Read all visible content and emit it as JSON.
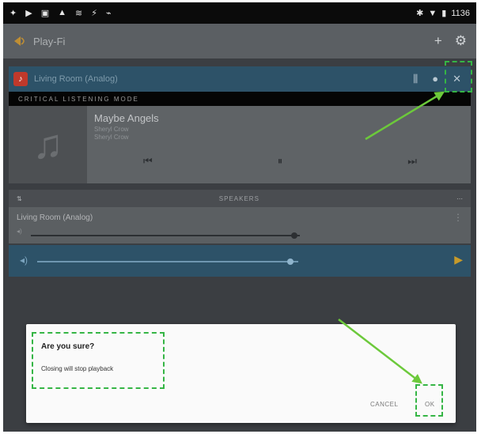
{
  "status_bar": {
    "left_icons": [
      "✦",
      "▶",
      "▣",
      "▲",
      "≋",
      "⚡",
      "⌁"
    ],
    "right_text": "1136"
  },
  "app_bar": {
    "title": "Play-Fi",
    "actions": [
      "+",
      "⚙"
    ]
  },
  "now_playing_bar": {
    "room_name": "Living Room (Analog)"
  },
  "mode_banner": "CRITICAL LISTENING MODE",
  "player": {
    "track_title": "Maybe Angels",
    "artist": "Sheryl Crow",
    "album": "Sheryl Crow",
    "controls": [
      "⏮",
      "⏸",
      "⏭"
    ]
  },
  "speakers": {
    "header": "SPEAKERS",
    "items": [
      {
        "name": "Living Room (Analog)",
        "volume": 0.98
      }
    ]
  },
  "master_volume": {
    "level": 0.97
  },
  "dialog": {
    "title": "Are you sure?",
    "message": "Closing will stop playback",
    "cancel_label": "CANCEL",
    "ok_label": "OK"
  },
  "annotation_color": "#35b545"
}
